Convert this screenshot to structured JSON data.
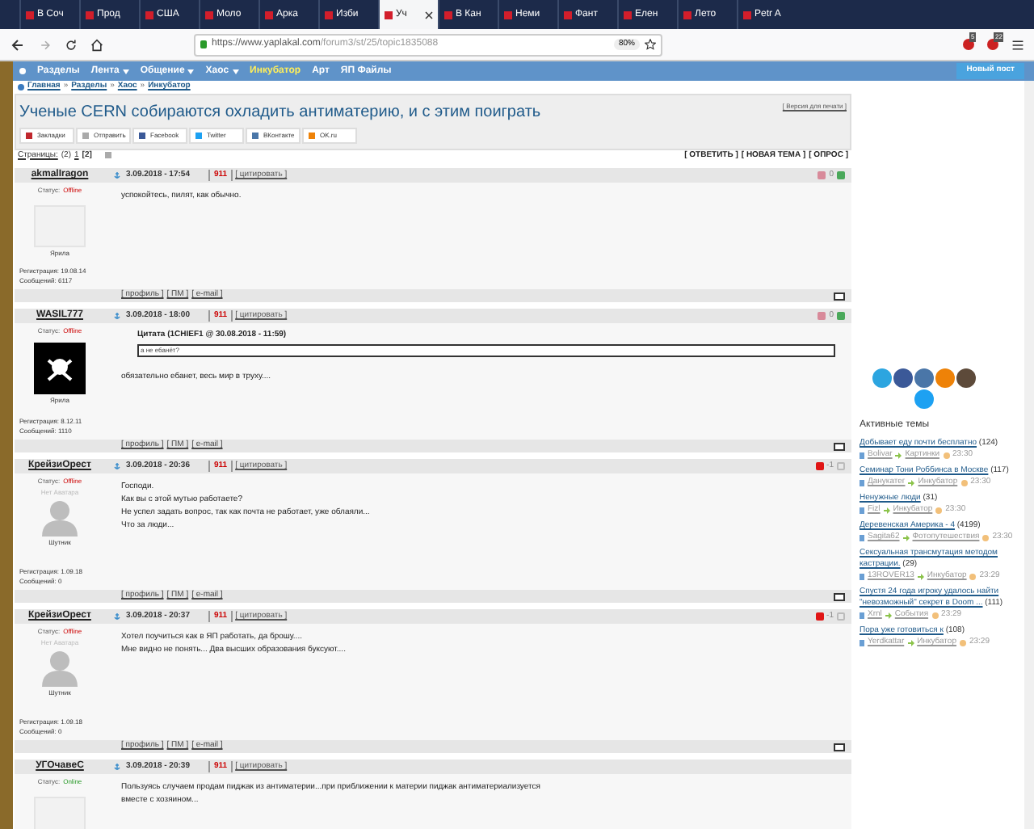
{
  "browser": {
    "tabs": [
      {
        "label": "В Соч",
        "selected": false
      },
      {
        "label": "Прод",
        "selected": false
      },
      {
        "label": "США",
        "selected": false
      },
      {
        "label": "Моло",
        "selected": false
      },
      {
        "label": "Арка",
        "selected": false
      },
      {
        "label": "Изби",
        "selected": false
      },
      {
        "label": "Уч",
        "selected": true
      },
      {
        "label": "В Кан",
        "selected": false
      },
      {
        "label": "Неми",
        "selected": false
      },
      {
        "label": "Фант",
        "selected": false
      },
      {
        "label": "Елен",
        "selected": false
      },
      {
        "label": "Лето",
        "selected": false
      },
      {
        "label": "Petr A",
        "selected": false
      }
    ],
    "url_host": "https://www.yaplakal.com",
    "url_path": "/forum3/st/25/topic1835088",
    "zoom": "80%",
    "badges": [
      "5",
      "22"
    ]
  },
  "nav": {
    "items": [
      {
        "label": "Разделы",
        "selected": false,
        "dropdown": false
      },
      {
        "label": "Лента",
        "selected": false,
        "dropdown": true
      },
      {
        "label": "Общение",
        "selected": false,
        "dropdown": true
      },
      {
        "label": "Хаос",
        "selected": false,
        "dropdown": true
      },
      {
        "label": "Инкубатор",
        "selected": true,
        "dropdown": false
      },
      {
        "label": "Арт",
        "selected": false,
        "dropdown": false
      },
      {
        "label": "ЯП Файлы",
        "selected": false,
        "dropdown": false
      }
    ],
    "new_post": "Новый пост"
  },
  "breadcrumb": {
    "separator": "»",
    "items": [
      "Главная",
      "Разделы",
      "Хаос",
      "Инкубатор"
    ]
  },
  "topic": {
    "title": "Ученые CERN собираются охладить антиматерию, и с этим поиграть",
    "print": "[ Версия для печати ]",
    "share": [
      "Закладки",
      "Отправить",
      "Facebook",
      "Twitter",
      "ВКонтакте",
      "OK.ru"
    ],
    "pages_label": "Страницы:",
    "pages_count": "(2)",
    "pages": [
      {
        "label": "1",
        "selected": false
      },
      {
        "label": "[2]",
        "selected": true
      }
    ],
    "actions": [
      "[ ОТВЕТИТЬ ]",
      "[ НОВАЯ ТЕМА ]",
      "[ ОПРОС ]"
    ]
  },
  "posts": [
    {
      "author": "akmalIragon",
      "status_label": "Статус:",
      "status": "Offline",
      "online": false,
      "avatar": {
        "kind": "image"
      },
      "rank": "Ярила",
      "registered": "Регистрация: 19.08.14",
      "messages": "Сообщений: 6117",
      "date": "3.09.2018 - 17:54",
      "report": "911",
      "quote_link": "[ цитировать ]",
      "rating": "0",
      "negative": false,
      "lines": [
        "успокойтесь, пилят, как обычно."
      ],
      "footer": [
        "[ профиль ]",
        "[ ПМ ]",
        "[ e-mail ]"
      ]
    },
    {
      "author": "WASIL777",
      "status_label": "Статус:",
      "status": "Offline",
      "online": false,
      "avatar": {
        "kind": "dark"
      },
      "rank": "Ярила",
      "registered": "Регистрация: 8.12.11",
      "messages": "Сообщений: 1110",
      "date": "3.09.2018 - 18:00",
      "report": "911",
      "quote_link": "[ цитировать ]",
      "rating": "0",
      "negative": false,
      "quote": {
        "header": "Цитата (1CHIEF1 @ 30.08.2018 - 11:59)",
        "text": "а не ебанёт?"
      },
      "lines": [
        "обязательно ебанет, весь мир в труху...."
      ],
      "footer": [
        "[ профиль ]",
        "[ ПМ ]",
        "[ e-mail ]"
      ]
    },
    {
      "author": "КрейзиОрест",
      "status_label": "Статус:",
      "status": "Offline",
      "online": false,
      "avatar": {
        "kind": "none",
        "label": "Нет Аватара"
      },
      "rank": "Шутник",
      "registered": "Регистрация: 1.09.18",
      "messages": "Сообщений: 0",
      "date": "3.09.2018 - 20:36",
      "report": "911",
      "quote_link": "[ цитировать ]",
      "rating": "-1",
      "negative": true,
      "lines": [
        "Господи.",
        "Как вы с этой мутью работаете?",
        "Не успел задать вопрос, так как почта не работает, уже облаяли...",
        "Что за люди..."
      ],
      "footer": [
        "[ профиль ]",
        "[ ПМ ]",
        "[ e-mail ]"
      ]
    },
    {
      "author": "КрейзиОрест",
      "status_label": "Статус:",
      "status": "Offline",
      "online": false,
      "avatar": {
        "kind": "none",
        "label": "Нет Аватара"
      },
      "rank": "Шутник",
      "registered": "Регистрация: 1.09.18",
      "messages": "Сообщений: 0",
      "date": "3.09.2018 - 20:37",
      "report": "911",
      "quote_link": "[ цитировать ]",
      "rating": "-1",
      "negative": true,
      "lines": [
        "Хотел поучиться как в ЯП работать, да брошу....",
        "Мне видно не понять... Два высших образования буксуют...."
      ],
      "footer": [
        "[ профиль ]",
        "[ ПМ ]",
        "[ e-mail ]"
      ]
    },
    {
      "author": "УГОчавеС",
      "status_label": "Статус:",
      "status": "Online",
      "online": true,
      "avatar": {
        "kind": "image"
      },
      "date": "3.09.2018 - 20:39",
      "report": "911",
      "quote_link": "[ цитировать ]",
      "lines": [
        "Пользуясь случаем продам пиджак из антиматерии...при приближении к материи пиджак антиматериализуется",
        "вместе с хозяином..."
      ]
    }
  ],
  "sidebar": {
    "title": "Активные темы",
    "topics": [
      {
        "title": "Добывает еду почти бесплатно",
        "count": "(124)",
        "user": "Bolivar",
        "section": "Картинки",
        "time": "23:30"
      },
      {
        "title": "Семинар Тони Роббинса в Москве",
        "count": "(117)",
        "user": "Данукатег",
        "section": "Инкубатор",
        "time": "23:30"
      },
      {
        "title": "Ненужные люди",
        "count": "(31)",
        "user": "Fizl",
        "section": "Инкубатор",
        "time": "23:30"
      },
      {
        "title": "Деревенская Америка - 4",
        "count": "(4199)",
        "user": "Sagita62",
        "section": "Фотопутешествия",
        "time": "23:30"
      },
      {
        "title": "Сексуальная трансмутация методом кастрации.",
        "count": "(29)",
        "user": "13ROVER13",
        "section": "Инкубатор",
        "time": "23:29"
      },
      {
        "title": "Спустя 24 года игроку удалось найти \"невозможный\" секрет в Doom ...",
        "count": "(111)",
        "user": "Xrnl",
        "section": "События",
        "time": "23:29"
      },
      {
        "title": "Пора уже готовиться к",
        "count": "(108)",
        "user": "Yerdkattar",
        "section": "Инкубатор",
        "time": "23:29"
      }
    ]
  }
}
